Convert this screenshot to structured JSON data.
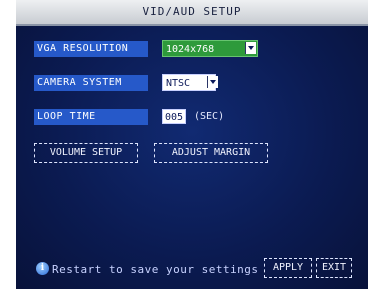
{
  "window": {
    "title": "VID/AUD SETUP"
  },
  "settings": {
    "vga_resolution": {
      "label": "VGA RESOLUTION",
      "value": "1024x768"
    },
    "camera_system": {
      "label": "CAMERA SYSTEM",
      "value": "NTSC"
    },
    "loop_time": {
      "label": "LOOP TIME",
      "value": "005",
      "unit": "(SEC)"
    }
  },
  "buttons": {
    "volume_setup": "VOLUME SETUP",
    "adjust_margin": "ADJUST MARGIN",
    "apply": "APPLY",
    "exit": "EXIT"
  },
  "hint": {
    "text": "Restart to save your settings"
  },
  "colors": {
    "background": "#0a1640",
    "label_bg": "#2659c9",
    "selected_bg": "#2e9a3b"
  },
  "icons": {
    "info": "info-icon",
    "dropdown": "chevron-down-icon"
  }
}
